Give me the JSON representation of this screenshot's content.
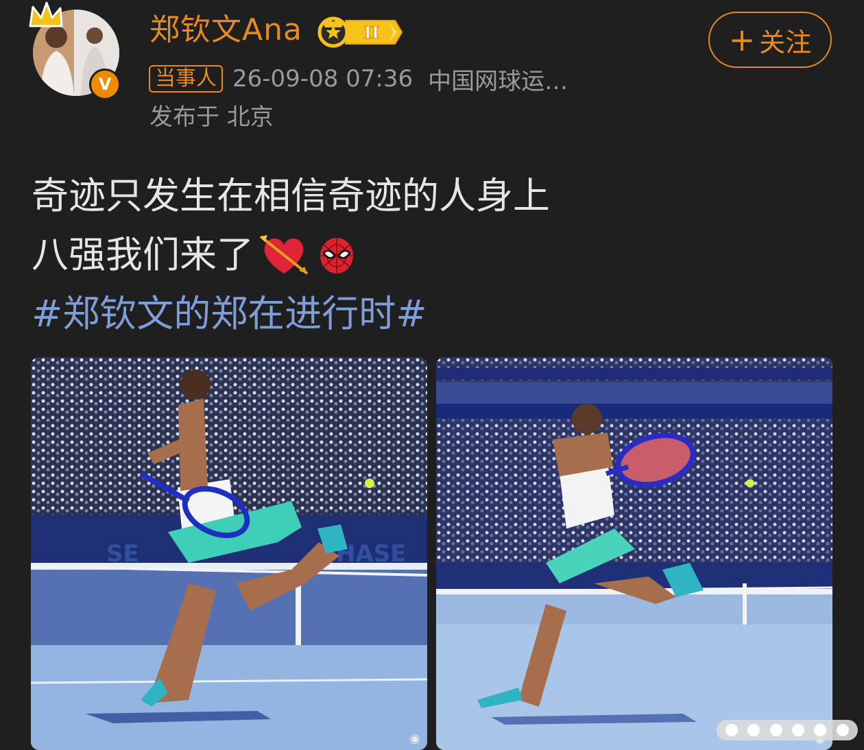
{
  "post": {
    "author": {
      "name": "郑钦文Ana",
      "verified_badge": "V",
      "level_badge": "II",
      "avatar_icon": "avatar-photo"
    },
    "follow_button": {
      "plus": "+",
      "label": "关注"
    },
    "role_tag": "当事人",
    "time": "26-09-08 07:36",
    "source": "中国网球运…",
    "location": "发布于 北京",
    "text_line1": "奇迹只发生在相信奇迹的人身上",
    "text_line2": "八强我们来了",
    "hashtag": "#郑钦文的郑在进行时#",
    "emojis": [
      "heart-arrow-emoji",
      "spider-man-emoji"
    ],
    "images": [
      {
        "icon": "tennis-photo-backhand"
      },
      {
        "icon": "tennis-photo-forehand"
      }
    ],
    "colors": {
      "background": "#1f1f1f",
      "accent": "#e98a1e",
      "hashtag": "#7f9ed9",
      "meta": "#9a9a9a",
      "text": "#e6e6e6"
    }
  }
}
